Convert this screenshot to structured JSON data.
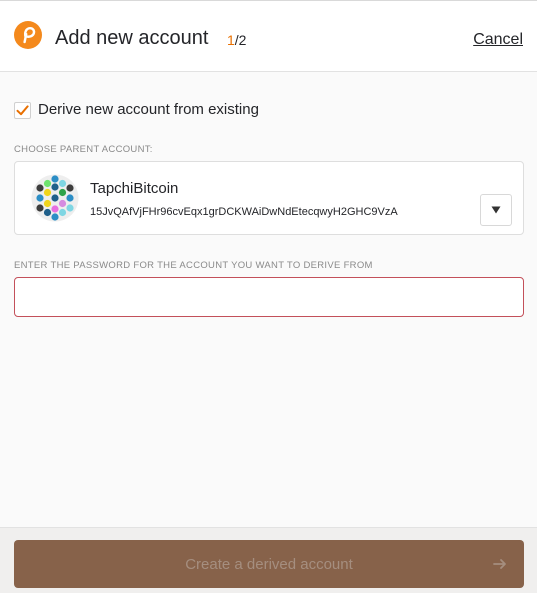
{
  "header": {
    "title": "Add new account",
    "step_current": "1",
    "step_total": "/2",
    "cancel_label": "Cancel"
  },
  "derive": {
    "checkbox_label": "Derive new account from existing",
    "checked": true
  },
  "parent_account": {
    "section_label": "CHOOSE PARENT ACCOUNT:",
    "name": "TapchiBitcoin",
    "address": "15JvQAfVjFHr96cvEqx1grDCKWAiDwNdEtecqwyH2GHC9VzA"
  },
  "password": {
    "section_label": "ENTER THE PASSWORD FOR THE ACCOUNT YOU WANT TO DERIVE FROM",
    "value": ""
  },
  "footer": {
    "button_label": "Create a derived account"
  },
  "icons": {
    "logo": "polkadot-logo-icon",
    "checkbox": "check-icon",
    "dropdown": "triangle-down-icon",
    "button": "arrow-right-icon",
    "avatar": "identicon-icon"
  },
  "colors": {
    "accent": "#e86f00",
    "primary_button": "#87624a",
    "input_error_border": "#c3505a"
  }
}
